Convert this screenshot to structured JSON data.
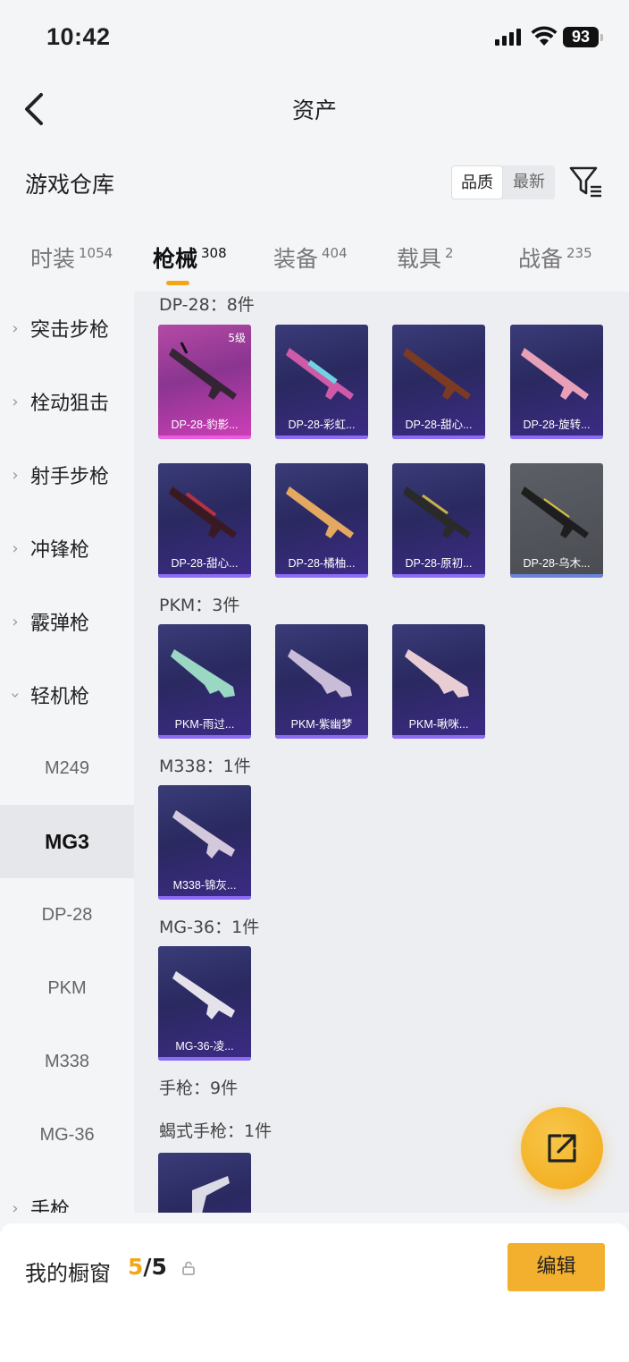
{
  "status_bar": {
    "time": "10:42",
    "battery": "93"
  },
  "nav": {
    "title": "资产"
  },
  "section": {
    "title": "游戏仓库",
    "sort_options": [
      "品质",
      "最新"
    ],
    "sort_selected": "品质"
  },
  "tabs": [
    {
      "label": "时装",
      "count": "1054"
    },
    {
      "label": "枪械",
      "count": "308"
    },
    {
      "label": "装备",
      "count": "404"
    },
    {
      "label": "载具",
      "count": "2"
    },
    {
      "label": "战备",
      "count": "235"
    }
  ],
  "sidebar": {
    "categories": [
      "突击步枪",
      "栓动狙击",
      "射手步枪",
      "冲锋枪",
      "霰弹枪",
      "轻机枪"
    ],
    "subitems": [
      "M249",
      "MG3",
      "DP-28",
      "PKM",
      "M338",
      "MG-36"
    ],
    "selected": "MG3",
    "last_category": "手枪"
  },
  "groups": {
    "dp28": {
      "label": "DP-28：8件",
      "items": [
        {
          "name": "DP-28-豹影...",
          "level": "5级"
        },
        {
          "name": "DP-28-彩虹..."
        },
        {
          "name": "DP-28-甜心..."
        },
        {
          "name": "DP-28-旋转..."
        },
        {
          "name": "DP-28-甜心..."
        },
        {
          "name": "DP-28-橘柚..."
        },
        {
          "name": "DP-28-原初..."
        },
        {
          "name": "DP-28-乌木..."
        }
      ]
    },
    "pkm": {
      "label": "PKM：3件",
      "items": [
        {
          "name": "PKM-雨过..."
        },
        {
          "name": "PKM-紫幽梦"
        },
        {
          "name": "PKM-啾咪..."
        }
      ]
    },
    "m338": {
      "label": "M338：1件",
      "items": [
        {
          "name": "M338-锦灰..."
        }
      ]
    },
    "mg36": {
      "label": "MG-36：1件",
      "items": [
        {
          "name": "MG-36-凌..."
        }
      ]
    },
    "pistol": {
      "label": "手枪：9件"
    },
    "scorpion": {
      "label": "蝎式手枪：1件"
    }
  },
  "bottom": {
    "showcase_label": "我的橱窗",
    "showcase_current": "5",
    "showcase_total": "/5",
    "edit_label": "编辑"
  },
  "colors": {
    "accent": "#f3a716",
    "card_epic": "#2a2960",
    "card_legend": "#b44aa5"
  },
  "icons": [
    "back-icon",
    "filter-icon",
    "share-icon",
    "lock-icon",
    "wifi-icon",
    "signal-icon"
  ]
}
